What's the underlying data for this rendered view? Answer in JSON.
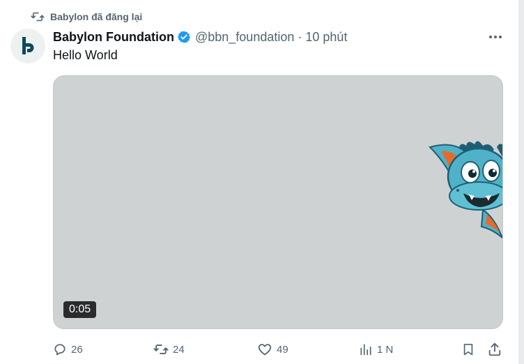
{
  "repost": {
    "label": "Babylon đã đăng lại",
    "icon": "repost-icon"
  },
  "author": {
    "avatar_letter": "b",
    "display_name": "Babylon Foundation",
    "handle": "@bbn_foundation",
    "separator": "·",
    "time": "10 phút",
    "verified_color": "#1d9bf0"
  },
  "tweet": {
    "text": "Hello World"
  },
  "media": {
    "type": "video",
    "duration": "0:05",
    "background": "#cfd2d3"
  },
  "actions": {
    "replies": "26",
    "reposts": "24",
    "likes": "49",
    "views": "1 N"
  },
  "colors": {
    "secondary_text": "#536471",
    "primary_text": "#0f1419",
    "brand_dark": "#0d4a5b"
  }
}
